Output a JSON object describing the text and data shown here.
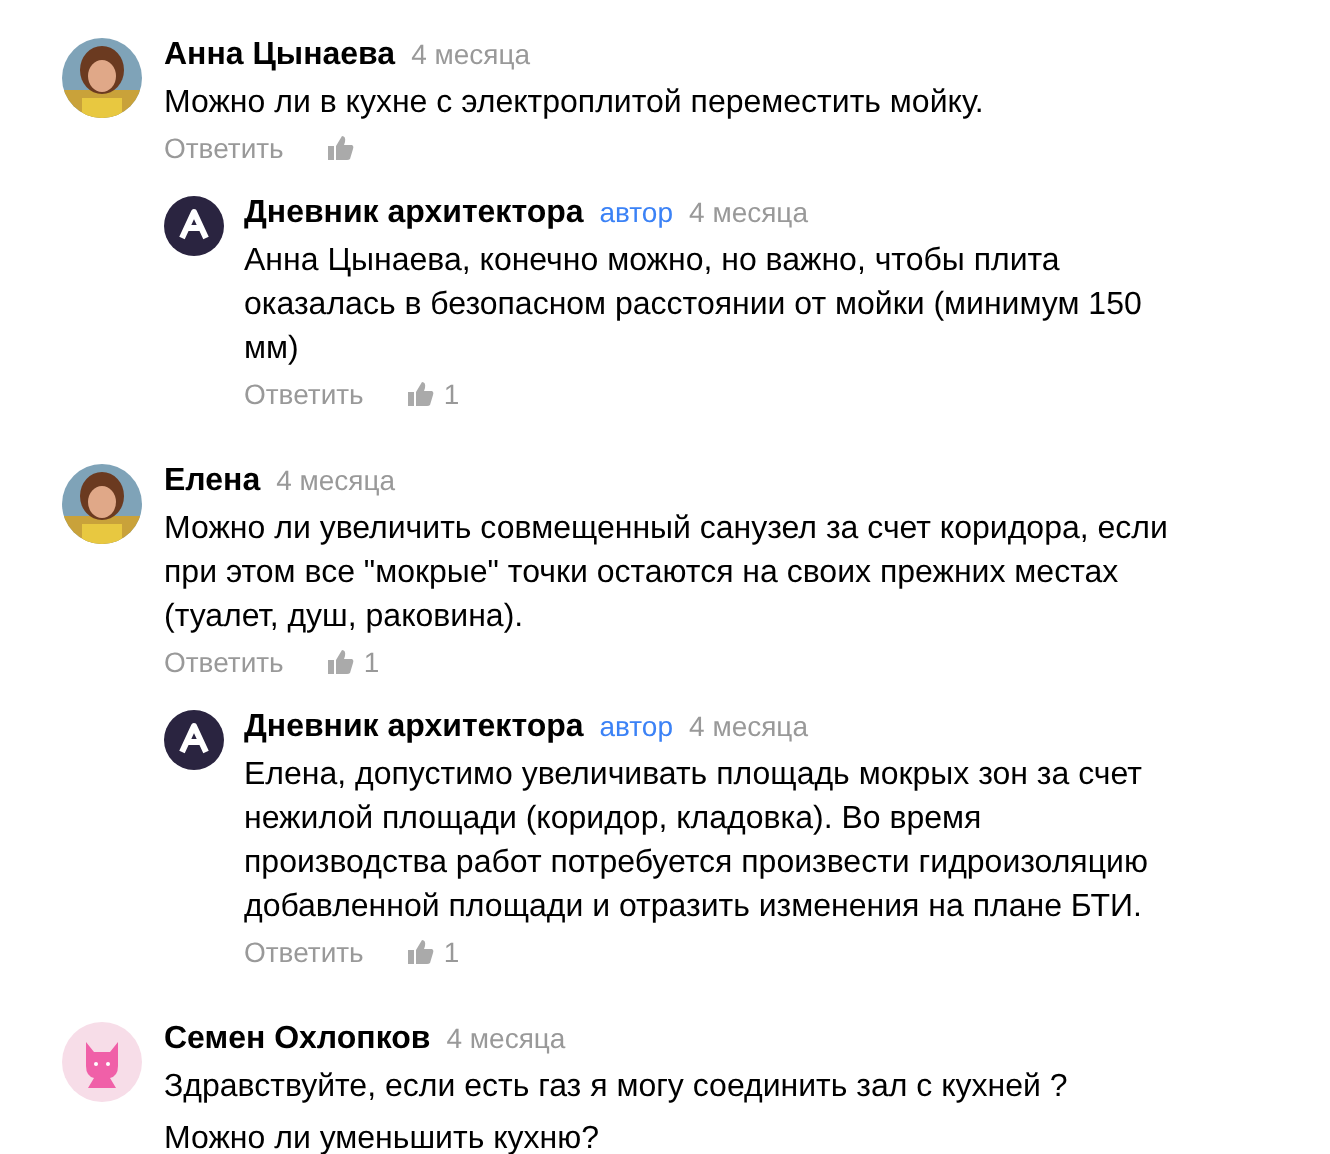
{
  "comments": [
    {
      "author": "Анна Цынаева",
      "time": "4 месяца",
      "text": [
        "Можно ли в кухне с электроплитой переместить мойку."
      ],
      "reply_label": "Ответить",
      "children": [
        {
          "author": "Дневник архитектора",
          "badge": "автор",
          "time": "4 месяца",
          "kind": "logo",
          "text": [
            "Анна Цынаева, конечно можно, но важно, чтобы плита оказалась в безопасном расстоянии от мойки (минимум 150 мм)"
          ],
          "reply_label": "Ответить",
          "likes": "1"
        }
      ]
    },
    {
      "author": "Елена",
      "time": "4 месяца",
      "text": [
        "Можно ли увеличить совмещенный санузел за счет коридора, если при этом все \"мокрые\" точки остаются на своих прежних местах (туалет, душ, раковина)."
      ],
      "reply_label": "Ответить",
      "likes": "1",
      "children": [
        {
          "author": "Дневник архитектора",
          "badge": "автор",
          "time": "4 месяца",
          "kind": "logo",
          "text": [
            "Елена, допустимо увеличивать площадь мокрых зон за счет нежилой площади (коридор, кладовка). Во время производства работ потребуется произвести гидроизоляцию добавленной площади и отразить изменения на плане БТИ."
          ],
          "reply_label": "Ответить",
          "likes": "1"
        }
      ]
    },
    {
      "author": "Семен Охлопков",
      "time": "4 месяца",
      "kind": "cat",
      "text": [
        "Здравствуйте, если есть газ я могу соединить зал с кухней ?",
        "Можно ли уменьшить кухню?"
      ]
    }
  ]
}
